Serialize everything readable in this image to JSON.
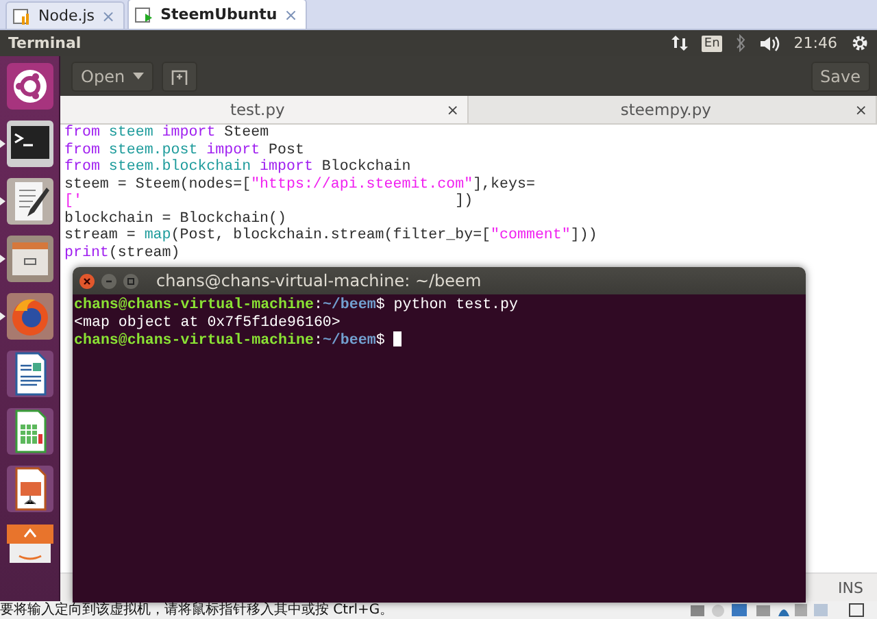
{
  "vm_tabs": [
    {
      "label": "Node.js",
      "selected": false,
      "close": "×"
    },
    {
      "label": "SteemUbuntu",
      "selected": true,
      "close": "×"
    }
  ],
  "top_panel": {
    "title": "Terminal",
    "keyboard": "En",
    "time": "21:46"
  },
  "launcher": [
    {
      "kind": "ubuntu",
      "running": false
    },
    {
      "kind": "terminal",
      "running": true
    },
    {
      "kind": "editor",
      "running": true
    },
    {
      "kind": "files",
      "running": true
    },
    {
      "kind": "firefox",
      "running": true
    },
    {
      "kind": "writer",
      "running": false
    },
    {
      "kind": "calc",
      "running": false
    },
    {
      "kind": "impress",
      "running": false
    },
    {
      "kind": "amazon",
      "running": false
    }
  ],
  "toolbar": {
    "open": "Open",
    "save": "Save"
  },
  "editor_tabs": [
    {
      "label": "test.py",
      "selected": true,
      "close": "×"
    },
    {
      "label": "steempy.py",
      "selected": false,
      "close": "×"
    }
  ],
  "code_lines": [
    [
      {
        "text": "from",
        "kind": "keyword"
      },
      {
        "text": " steem",
        "kind": "module"
      },
      {
        "text": " import",
        "kind": "keyword"
      },
      {
        "text": " Steem"
      }
    ],
    [
      {
        "text": "from",
        "kind": "keyword"
      },
      {
        "text": " steem.post",
        "kind": "module"
      },
      {
        "text": " import",
        "kind": "keyword"
      },
      {
        "text": " Post"
      }
    ],
    [
      {
        "text": "from",
        "kind": "keyword"
      },
      {
        "text": " steem.blockchain",
        "kind": "module"
      },
      {
        "text": " import",
        "kind": "keyword"
      },
      {
        "text": " Blockchain"
      }
    ],
    [
      {
        "text": "steem = Steem(nodes=["
      },
      {
        "text": "\"https://api.steemit.com\"",
        "kind": "string"
      },
      {
        "text": "],keys="
      }
    ],
    [
      {
        "text": "['",
        "kind": "string"
      },
      {
        "text": "                                          ])"
      }
    ],
    [
      {
        "text": "blockchain = Blockchain()"
      }
    ],
    [
      {
        "text": "stream = "
      },
      {
        "text": "map",
        "kind": "builtin"
      },
      {
        "text": "(Post, blockchain.stream(filter_by=["
      },
      {
        "text": "\"comment\"",
        "kind": "string"
      },
      {
        "text": "]))"
      }
    ],
    [
      {
        "text": "print",
        "kind": "keyword"
      },
      {
        "text": "(stream)"
      }
    ]
  ],
  "gedit_status": "INS",
  "terminal": {
    "title": "chans@chans-virtual-machine: ~/beem",
    "lines": [
      [
        {
          "text": "chans@chans-virtual-machine",
          "kind": "user"
        },
        {
          "text": ":"
        },
        {
          "text": "~/beem",
          "kind": "path"
        },
        {
          "text": "$ python test.py"
        }
      ],
      [
        {
          "text": "<map object at 0x7f5f1de96160>"
        }
      ],
      [
        {
          "text": "chans@chans-virtual-machine",
          "kind": "user"
        },
        {
          "text": ":"
        },
        {
          "text": "~/beem",
          "kind": "path"
        },
        {
          "text": "$ "
        }
      ]
    ]
  },
  "vm_status": "要将输入定向到该虚拟机，请将鼠标指针移入其中或按 Ctrl+G。"
}
